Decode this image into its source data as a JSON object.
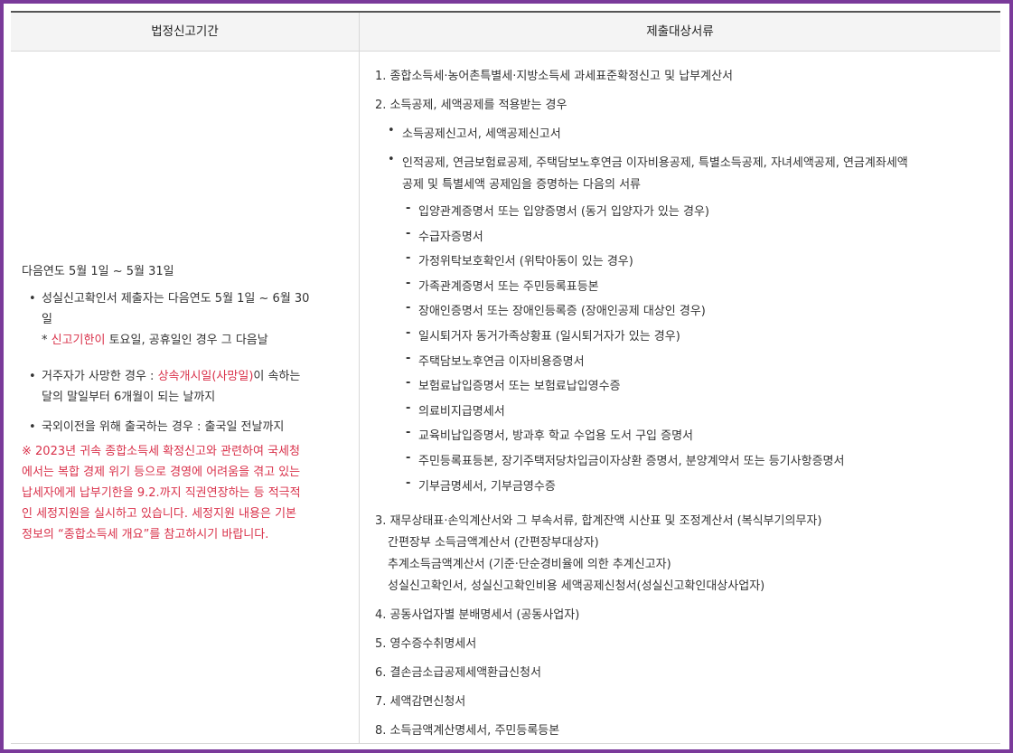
{
  "header": {
    "col1": "법정신고기간",
    "col2": "제출대상서류"
  },
  "left": {
    "period": "다음연도 5월 1일 ~ 5월 31일",
    "bullets": {
      "b1_line1": "성실신고확인서 제출자는 다음연도 5월 1일 ~ 6월 30",
      "b1_line2": "일",
      "b1_note_prefix": "* ",
      "b1_note_red": "신고기한이",
      "b1_note_rest": " 토요일, 공휴일인 경우 그 다음날",
      "b2_prefix": "거주자가 사망한 경우 : ",
      "b2_red": "상속개시일(사망일)",
      "b2_rest": "이 속하는",
      "b2_line2": "달의 말일부터 6개월이 되는 날까지",
      "b3": "국외이전을 위해 출국하는 경우 : 출국일 전날까지"
    },
    "notice": [
      "※ 2023년 귀속 종합소득세 확정신고와 관련하여 국세청",
      "에서는 복합 경제 위기 등으로 경영에 어려움을 겪고 있는",
      "납세자에게 납부기한을 9.2.까지 직권연장하는 등 적극적",
      "인 세정지원을 실시하고 있습니다. 세정지원 내용은 기본",
      "정보의 “종합소득세 개요”를 참고하시기 바랍니다."
    ]
  },
  "right": {
    "item1": "1. 종합소득세·농어촌특별세·지방소득세 과세표준확정신고 및 납부계산서",
    "item2": "2. 소득공제, 세액공제를 적용받는 경우",
    "sub1": "소득공제신고서, 세액공제신고서",
    "sub2_line1": "인적공제, 연금보험료공제, 주택담보노후연금 이자비용공제, 특별소득공제, 자녀세액공제, 연금계좌세액",
    "sub2_line2": "공제 및 특별세액 공제임을 증명하는 다음의 서류",
    "dashes": [
      "입양관계증명서 또는 입양증명서 (동거 입양자가 있는 경우)",
      "수급자증명서",
      "가정위탁보호확인서 (위탁아동이 있는 경우)",
      "가족관계증명서 또는 주민등록표등본",
      "장애인증명서 또는 장애인등록증 (장애인공제 대상인 경우)",
      "일시퇴거자 동거가족상황표 (일시퇴거자가 있는 경우)",
      "주택담보노후연금 이자비용증명서",
      "보험료납입증명서 또는 보험료납입영수증",
      "의료비지급명세서",
      "교육비납입증명서, 방과후 학교 수업용 도서 구입 증명서",
      "주민등록표등본, 장기주택저당차입금이자상환 증명서, 분양계약서 또는 등기사항증명서",
      "기부금명세서, 기부금영수증"
    ],
    "item3_line1": "3. 재무상태표·손익계산서와 그 부속서류, 합계잔액 시산표 및 조정계산서 (복식부기의무자)",
    "item3_line2": "간편장부 소득금액계산서 (간편장부대상자)",
    "item3_line3": "추계소득금액계산서 (기준·단순경비율에 의한 추계신고자)",
    "item3_line4": "성실신고확인서, 성실신고확인비용 세액공제신청서(성실신고확인대상사업자)",
    "item4": "4. 공동사업자별 분배명세서 (공동사업자)",
    "item5": "5. 영수증수취명세서",
    "item6": "6. 결손금소급공제세액환급신청서",
    "item7": "7. 세액감면신청서",
    "item8": "8. 소득금액계산명세서, 주민등록등본"
  }
}
